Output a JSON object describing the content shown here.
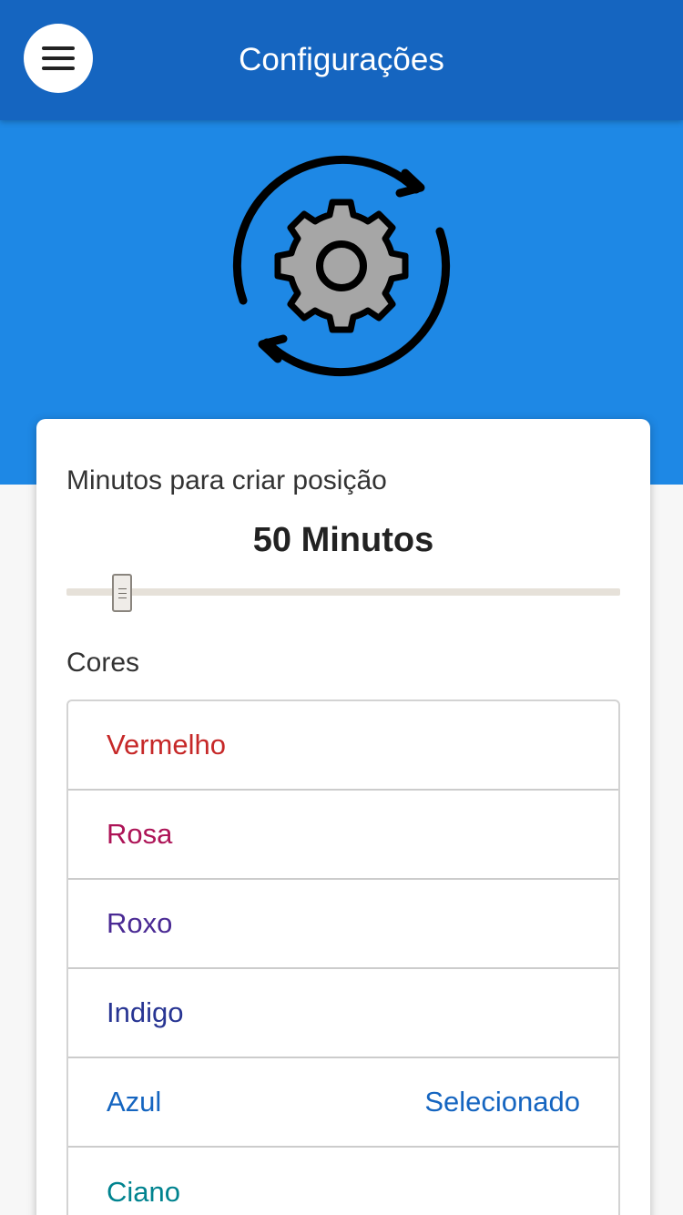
{
  "app_bar": {
    "title": "Configurações",
    "menu_icon": "hamburger-menu-icon",
    "color": "#1565c0"
  },
  "hero": {
    "icon": "gear-sync-icon",
    "color": "#1e88e5"
  },
  "settings": {
    "minutes_label": "Minutos para criar posição",
    "minutes_value": "50 Minutos",
    "minutes_slider_level": 50,
    "colors_label": "Cores",
    "colors": [
      {
        "label": "Vermelho",
        "status": "",
        "color": "#c62828"
      },
      {
        "label": "Rosa",
        "status": "",
        "color": "#ad1457"
      },
      {
        "label": "Roxo",
        "status": "",
        "color": "#4a2a94"
      },
      {
        "label": "Indigo",
        "status": "",
        "color": "#283593"
      },
      {
        "label": "Azul",
        "status": "Selecionado",
        "color": "#1565c0"
      },
      {
        "label": "Ciano",
        "status": "",
        "color": "#00838f"
      }
    ]
  }
}
